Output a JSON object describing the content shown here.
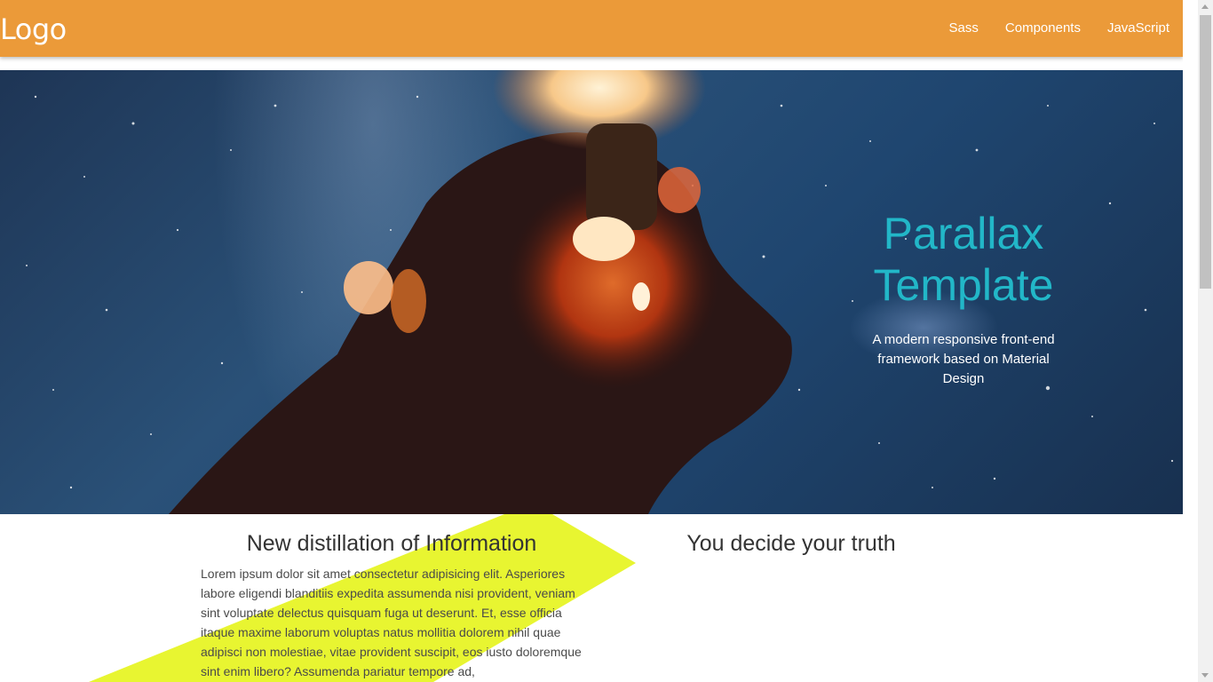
{
  "navbar": {
    "logo": "Logo",
    "links": [
      "Sass",
      "Components",
      "JavaScript"
    ]
  },
  "hero": {
    "title": "Parallax Template",
    "subtitle": "A modern responsive front-end framework based on Material Design",
    "image_description": "Hand holding a glowing light bulb against a starry night sky"
  },
  "sections": [
    {
      "heading": "New distillation of Information",
      "body": "Lorem ipsum dolor sit amet consectetur adipisicing elit. Asperiores labore eligendi blanditiis expedita assumenda nisi provident, veniam sint voluptate delectus quisquam fuga ut deserunt. Et, esse officia itaque maxime laborum voluptas natus mollitia dolorem nihil quae adipisci non molestiae, vitae provident suscipit, eos iusto doloremque sint enim libero? Assumenda pariatur tempore ad,"
    },
    {
      "heading": "You decide your truth",
      "body": ""
    }
  ],
  "colors": {
    "navbar": "#eb9a39",
    "hero_title": "#22b7c8",
    "accent_stripe": "#e8f531"
  }
}
